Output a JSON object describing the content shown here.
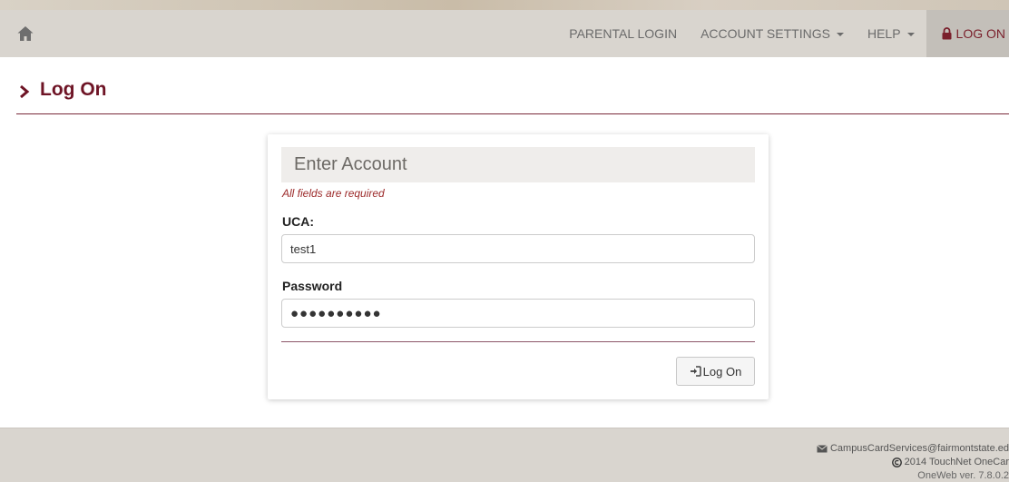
{
  "nav": {
    "home_icon": "home-icon",
    "items": [
      {
        "label": "PARENTAL LOGIN"
      },
      {
        "label": "ACCOUNT SETTINGS",
        "dropdown": true
      },
      {
        "label": "HELP",
        "dropdown": true
      },
      {
        "label": "LOG ON",
        "icon": "lock-icon",
        "active": true
      }
    ]
  },
  "page": {
    "title": "Log On",
    "title_icon": "chevron-right-icon"
  },
  "form": {
    "heading": "Enter Account",
    "required_note": "All fields are required",
    "uca_label": "UCA:",
    "uca_value": "test1",
    "password_label": "Password",
    "password_value": "●●●●●●●●●●",
    "submit_label": "Log On",
    "submit_icon": "sign-in-icon"
  },
  "footer": {
    "email": "CampusCardServices@fairmontstate.ed",
    "copyright": "2014 TouchNet OneCar",
    "version": "OneWeb ver. 7.8.0.2"
  },
  "colors": {
    "brand": "#6e1425",
    "navbar_bg": "#d9d5cf",
    "active_nav_bg": "#c3bfb9",
    "required_text": "#9c2a2a"
  }
}
